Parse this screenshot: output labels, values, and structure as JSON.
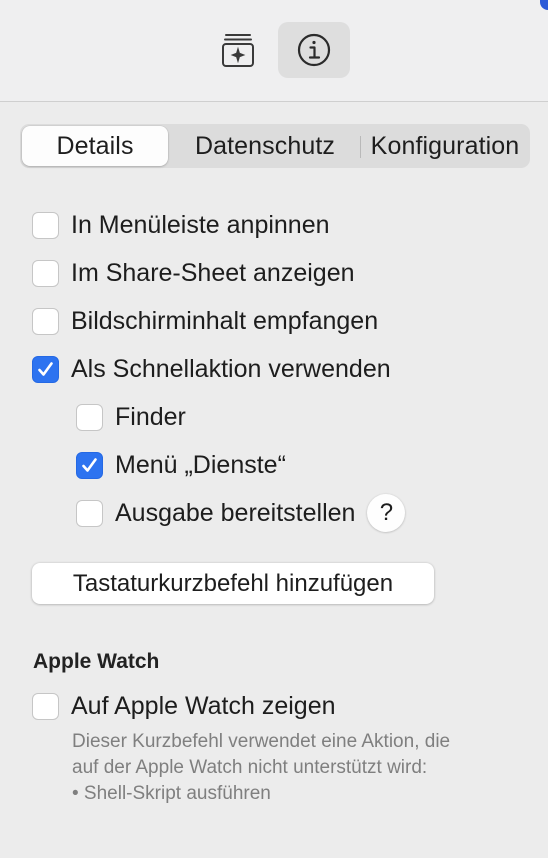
{
  "toolbar": {
    "add_icon": "add-to-dock-icon",
    "info_icon": "info-icon"
  },
  "tabs": [
    {
      "label": "Details",
      "selected": true
    },
    {
      "label": "Datenschutz",
      "selected": false
    },
    {
      "label": "Konfiguration",
      "selected": false
    }
  ],
  "options": {
    "pin_menubar": {
      "label": "In Menüleiste anpinnen",
      "checked": false
    },
    "share_sheet": {
      "label": "Im Share-Sheet anzeigen",
      "checked": false
    },
    "screen_content": {
      "label": "Bildschirminhalt empfangen",
      "checked": false
    },
    "quick_action": {
      "label": "Als Schnellaktion verwenden",
      "checked": true
    },
    "finder": {
      "label": "Finder",
      "checked": false
    },
    "services_menu": {
      "label": "Menü „Dienste“",
      "checked": true
    },
    "provide_output": {
      "label": "Ausgabe bereitstellen",
      "checked": false
    }
  },
  "help_label": "?",
  "shortcut_button": "Tastaturkurzbefehl hinzufügen",
  "apple_watch": {
    "heading": "Apple Watch",
    "show_label": "Auf Apple Watch zeigen",
    "show_checked": false,
    "note_line1": "Dieser Kurzbefehl verwendet eine Aktion, die",
    "note_line2": "auf der Apple Watch nicht unterstützt wird:",
    "note_line3": "• Shell-Skript ausführen"
  },
  "colors": {
    "accent": "#2d73f0",
    "background": "#ececec"
  }
}
